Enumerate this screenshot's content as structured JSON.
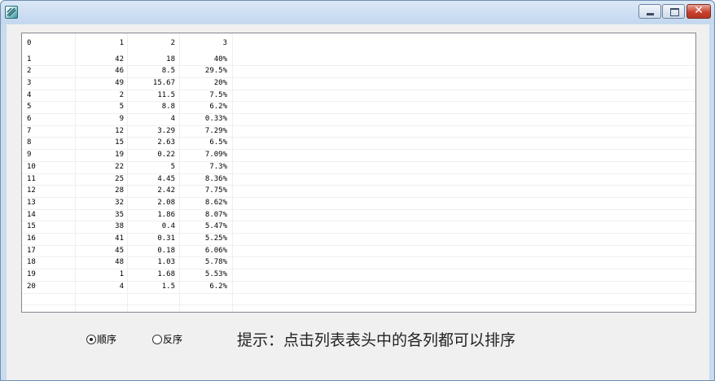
{
  "window": {
    "title": ""
  },
  "icons": {
    "app": "app-icon",
    "minimize": "minimize-icon",
    "maximize": "maximize-icon",
    "close": "close-icon"
  },
  "list": {
    "columns": [
      "0",
      "1",
      "2",
      "3"
    ],
    "rows": [
      [
        "1",
        "42",
        "18",
        "40%"
      ],
      [
        "2",
        "46",
        "8.5",
        "29.5%"
      ],
      [
        "3",
        "49",
        "15.67",
        "20%"
      ],
      [
        "4",
        "2",
        "11.5",
        "7.5%"
      ],
      [
        "5",
        "5",
        "8.8",
        "6.2%"
      ],
      [
        "6",
        "9",
        "4",
        "0.33%"
      ],
      [
        "7",
        "12",
        "3.29",
        "7.29%"
      ],
      [
        "8",
        "15",
        "2.63",
        "6.5%"
      ],
      [
        "9",
        "19",
        "0.22",
        "7.09%"
      ],
      [
        "10",
        "22",
        "5",
        "7.3%"
      ],
      [
        "11",
        "25",
        "4.45",
        "8.36%"
      ],
      [
        "12",
        "28",
        "2.42",
        "7.75%"
      ],
      [
        "13",
        "32",
        "2.08",
        "8.62%"
      ],
      [
        "14",
        "35",
        "1.86",
        "8.07%"
      ],
      [
        "15",
        "38",
        "0.4",
        "5.47%"
      ],
      [
        "16",
        "41",
        "0.31",
        "5.25%"
      ],
      [
        "17",
        "45",
        "0.18",
        "6.06%"
      ],
      [
        "18",
        "48",
        "1.03",
        "5.78%"
      ],
      [
        "19",
        "1",
        "1.68",
        "5.53%"
      ],
      [
        "20",
        "4",
        "1.5",
        "6.2%"
      ]
    ]
  },
  "sort": {
    "ascending_label": "顺序",
    "descending_label": "反序",
    "selected": "ascending"
  },
  "hint": "提示：点击列表表头中的各列都可以排序"
}
